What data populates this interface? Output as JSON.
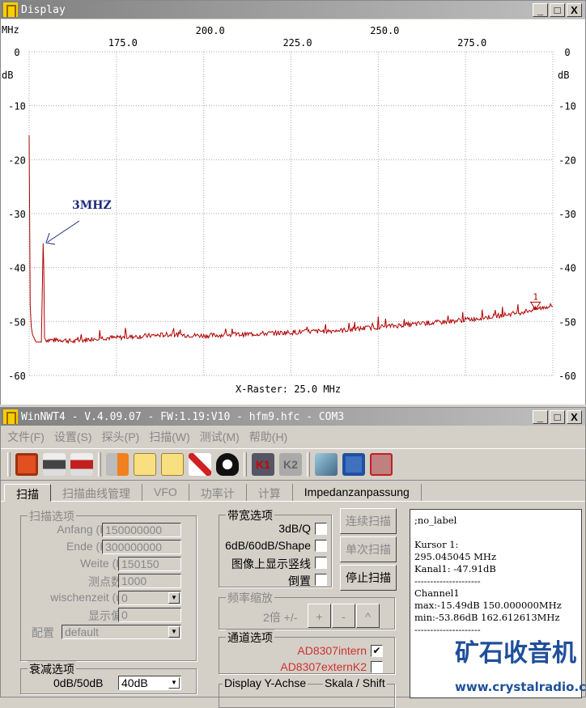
{
  "display": {
    "title": "Display",
    "x_unit": "MHz",
    "y_unit": "dB",
    "x_raster": "X-Raster: 25.0 MHz",
    "annotation": "3MHZ",
    "marker_label": "1"
  },
  "chart_data": {
    "type": "line",
    "title": "Display",
    "xlabel": "MHz",
    "ylabel": "dB",
    "xlim": [
      150,
      300
    ],
    "ylim": [
      -60,
      0
    ],
    "x_ticks_upper": [
      "200.0",
      "250.0"
    ],
    "x_ticks_lower": [
      "175.0",
      "225.0",
      "275.0"
    ],
    "x_tick_values_upper": [
      200,
      250
    ],
    "x_tick_values_lower": [
      175,
      225,
      275
    ],
    "y_ticks": [
      "0",
      "-10",
      "-20",
      "-30",
      "-40",
      "-50",
      "-60"
    ],
    "y_tick_values": [
      0,
      -10,
      -20,
      -30,
      -40,
      -50,
      -60
    ],
    "grid": true,
    "line_color": "#b00000",
    "series": [
      {
        "name": "Channel1",
        "x": [
          150,
          150.3,
          150.6,
          151,
          152,
          153.5,
          154,
          154.2,
          154.4,
          154.7,
          160,
          162.6,
          170,
          175,
          185,
          190,
          200,
          210,
          225,
          240,
          250,
          260,
          270,
          280,
          290,
          295,
          300
        ],
        "y": [
          -15.5,
          -47,
          -51,
          -52.5,
          -53.8,
          -53.8,
          -35.5,
          -40,
          -53,
          -53.6,
          -53.6,
          -53.9,
          -53.2,
          -53.2,
          -52.8,
          -52.6,
          -52.8,
          -52.6,
          -52.2,
          -51.8,
          -51.2,
          -50.7,
          -50.2,
          -49.5,
          -48.6,
          -47.9,
          -47.2
        ]
      }
    ],
    "marker": {
      "label": "1",
      "x": 295.045045,
      "y": -47.91
    }
  },
  "main": {
    "title": "WinNWT4 - V.4.09.07 - FW:1.19:V10 - hfm9.hfc - COM3",
    "menu": [
      "文件(F)",
      "设置(S)",
      "探头(P)",
      "扫描(W)",
      "测试(M)",
      "帮助(H)"
    ],
    "tabs": [
      "扫描",
      "扫描曲线管理",
      "VFO",
      "功率计",
      "计算",
      "Impedanzanpassung"
    ],
    "scan_options": {
      "title": "扫描选项",
      "anfang_label": "Anfang (Hz)",
      "anfang": "150000000",
      "ende_label": "Ende (Hz)",
      "ende": "300000000",
      "weite_label": "Weite (Hz)",
      "weite": "150150",
      "points_label": "测点数量",
      "points": "1000",
      "wait_label": "wischenzeit (uS)",
      "wait": "0",
      "offset_label": "显示偏移",
      "offset": "0",
      "config_label": "配置",
      "config": "default"
    },
    "atten": {
      "title": "衰减选项",
      "label": "0dB/50dB",
      "value": "40dB"
    },
    "bandwidth": {
      "title": "带宽选项",
      "items": [
        "3dB/Q",
        "6dB/60dB/Shape",
        "图像上显示竖线",
        "倒置"
      ]
    },
    "buttons": {
      "continuous": "连续扫描",
      "single": "单次扫描",
      "stop": "停止扫描"
    },
    "zoom": {
      "title": "频率缩放",
      "label": "2倍 +/-",
      "plus": "+",
      "minus": "-",
      "up": "^"
    },
    "channel": {
      "title": "通道选项",
      "ch1": "AD8307intern",
      "ch2": "AD8307externK2",
      "ch1_checked": true,
      "ch2_checked": false
    },
    "yaxis": {
      "left": "Display Y-Achse",
      "right": "Skala / Shift"
    },
    "info": {
      "l1": ";no_label",
      "l2": "Kursor 1:",
      "l3": "295.045045 MHz",
      "l4": "Kanal1: -47.91dB",
      "sep": "---------------------",
      "l5": "Channel1",
      "l6": "max:-15.49dB 150.000000MHz",
      "l7": "min:-53.86dB 162.612613MHz"
    },
    "watermark": {
      "cn": "矿石收音机",
      "url": "www.crystalradio.cn"
    }
  }
}
